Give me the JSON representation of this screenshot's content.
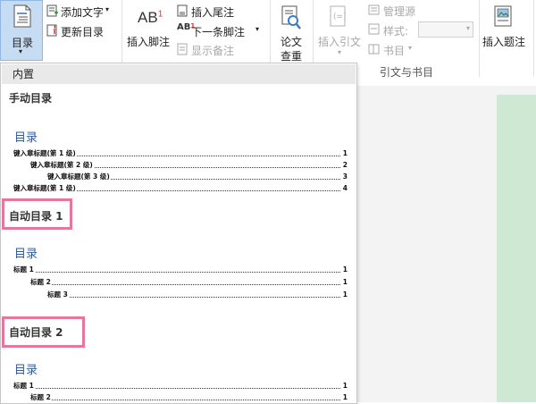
{
  "ribbon": {
    "toc_button": "目录",
    "add_text": "添加文字",
    "update_toc": "更新目录",
    "insert_footnote": "插入脚注",
    "insert_endnote": "插入尾注",
    "next_footnote": "下一条脚注",
    "show_notes": "显示备注",
    "thesis_check_line1": "论文",
    "thesis_check_line2": "查重",
    "insert_citation": "插入引文",
    "manage_sources": "管理源",
    "style_label": "样式:",
    "bibliography": "书目",
    "insert_caption": "插入题注",
    "group_citations": "引文与书目",
    "footnote_icon_text": "AB",
    "footnote_icon_sup": "1"
  },
  "dropdown": {
    "header": "内置",
    "manual_label": "手动目录",
    "auto1_label": "自动目录 1",
    "auto2_label": "自动目录 2",
    "preview_title": "目录",
    "manual_entries": [
      {
        "text": "键入章标题(第 1 级)",
        "page": "1"
      },
      {
        "text": "键入章标题(第 2 级)",
        "page": "2"
      },
      {
        "text": "键入章标题(第 3 级)",
        "page": "3"
      },
      {
        "text": "键入章标题(第 1 级)",
        "page": "4"
      }
    ],
    "auto1_entries": [
      {
        "text": "标题 1",
        "page": "1"
      },
      {
        "text": "标题 2",
        "page": "1"
      },
      {
        "text": "标题 3",
        "page": "1"
      }
    ],
    "auto2_entries": [
      {
        "text": "标题 1",
        "page": "1"
      },
      {
        "text": "标题 2",
        "page": "1"
      }
    ]
  },
  "colors": {
    "toc_title": "#2e5a9a",
    "highlight": "#e6779c",
    "page_bg": "#cfe8d4"
  }
}
